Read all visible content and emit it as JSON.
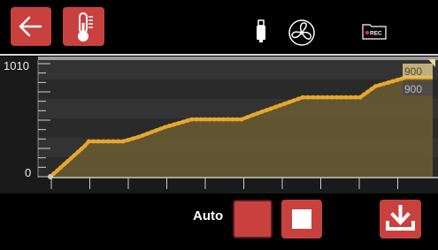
{
  "toolbar": {
    "back_icon": "back-arrow-icon",
    "temperature_icon": "thermometer-icon",
    "usb_icon": "usb-icon",
    "fan_icon": "fan-icon",
    "rec_label": "REC"
  },
  "colors": {
    "button": "#c8413f",
    "series": "#e8a72a",
    "fill": "#6b5c33",
    "marker": "#efbe63"
  },
  "chart_data": {
    "type": "line",
    "y_tick_labels": [
      "1010",
      "0"
    ],
    "ylim": [
      0,
      1010
    ],
    "markers": [
      "900",
      "900"
    ],
    "series": [
      {
        "x": [
          0,
          0.09,
          0.1,
          0.19,
          0.23,
          0.3,
          0.37,
          0.5,
          0.53,
          0.66,
          0.7,
          0.81,
          0.85,
          0.93,
          0.96,
          1
        ],
        "values": [
          0,
          280,
          320,
          320,
          360,
          450,
          520,
          520,
          560,
          720,
          720,
          720,
          820,
          900,
          900,
          900
        ]
      }
    ]
  },
  "controls": {
    "auto_label": "Auto",
    "auto_icon": "auto-toggle",
    "stop_icon": "stop-icon",
    "download_icon": "download-icon"
  }
}
